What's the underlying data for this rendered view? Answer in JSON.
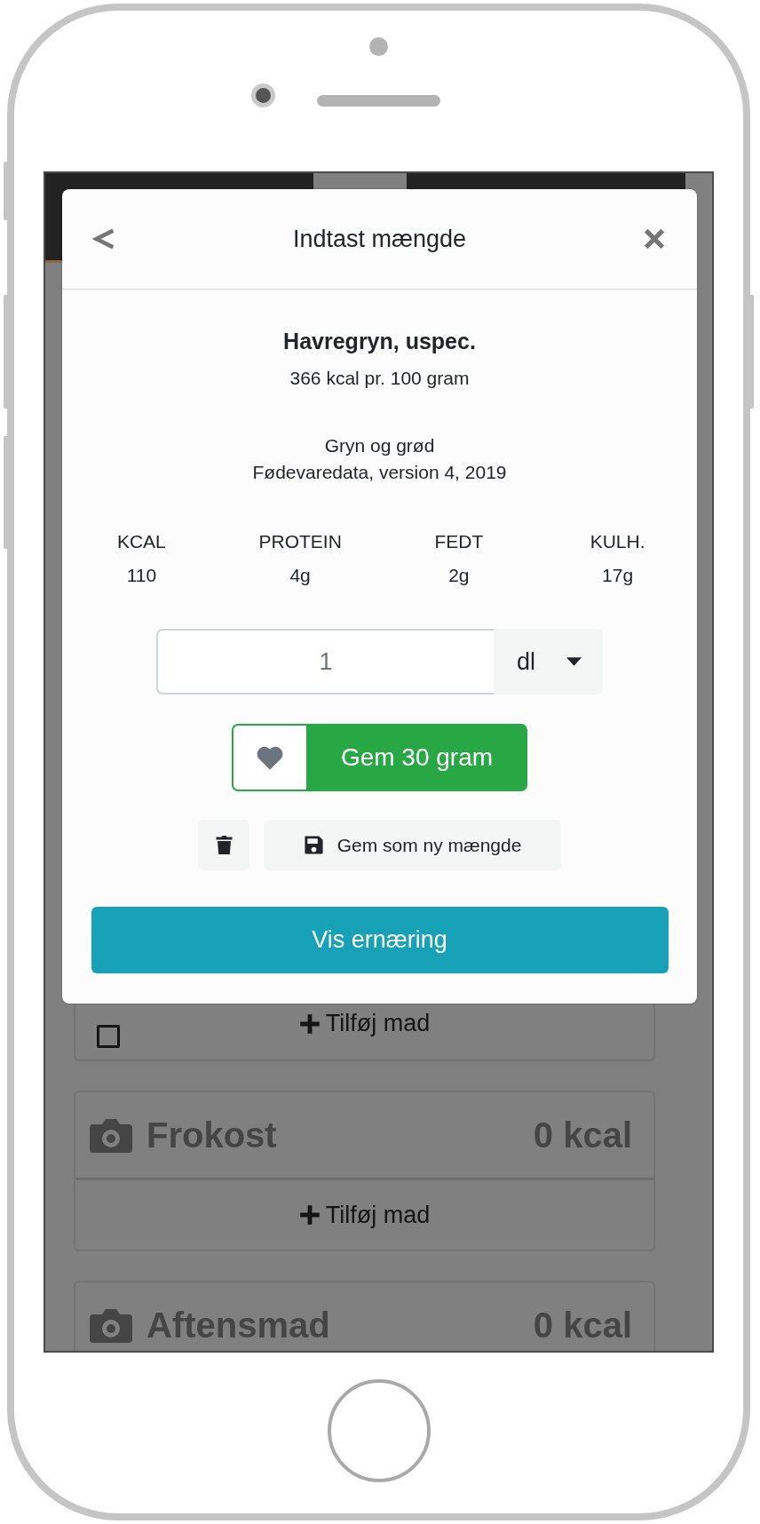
{
  "modal": {
    "title": "Indtast mængde",
    "food": {
      "name": "Havregryn, uspec.",
      "energy": "366 kcal pr. 100 gram",
      "category": "Gryn og grød",
      "source": "Fødevaredata, version 4, 2019"
    },
    "macros": [
      {
        "label": "KCAL",
        "value": "110"
      },
      {
        "label": "PROTEIN",
        "value": "4g"
      },
      {
        "label": "FEDT",
        "value": "2g"
      },
      {
        "label": "KULH.",
        "value": "17g"
      }
    ],
    "amount": {
      "value": "1",
      "unit": "dl"
    },
    "favorite": false,
    "save_button": "Gem 30 gram",
    "save_new_amount": "Gem som ny mængde",
    "nutrition_button": "Vis ernæring"
  },
  "meals": [
    {
      "add_label": "Tilføj mad",
      "checked": false
    },
    {
      "name": "Frokost",
      "kcal": "0 kcal",
      "add_label": "Tilføj mad"
    },
    {
      "name": "Aftensmad",
      "kcal": "0 kcal"
    }
  ]
}
